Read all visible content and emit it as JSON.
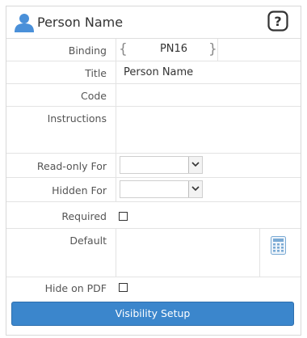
{
  "header": {
    "title": "Person Name",
    "icon": "person-icon",
    "help_icon": "help-icon"
  },
  "fields": {
    "binding": {
      "label": "Binding",
      "value": "PN16",
      "open_brace": "{",
      "close_brace": "}"
    },
    "title": {
      "label": "Title",
      "value": "Person Name"
    },
    "code": {
      "label": "Code",
      "value": ""
    },
    "instructions": {
      "label": "Instructions",
      "value": ""
    },
    "read_only_for": {
      "label": "Read-only For",
      "value": ""
    },
    "hidden_for": {
      "label": "Hidden For",
      "value": ""
    },
    "required": {
      "label": "Required",
      "checked": false
    },
    "default": {
      "label": "Default",
      "value": "",
      "icon": "calculator-icon"
    },
    "hide_on_pdf": {
      "label": "Hide on PDF",
      "checked": false
    }
  },
  "visibility_button": {
    "label": "Visibility Setup"
  },
  "colors": {
    "accent": "#3b86cc",
    "person_icon": "#4a90d9",
    "calculator_icon": "#7aaad4"
  }
}
